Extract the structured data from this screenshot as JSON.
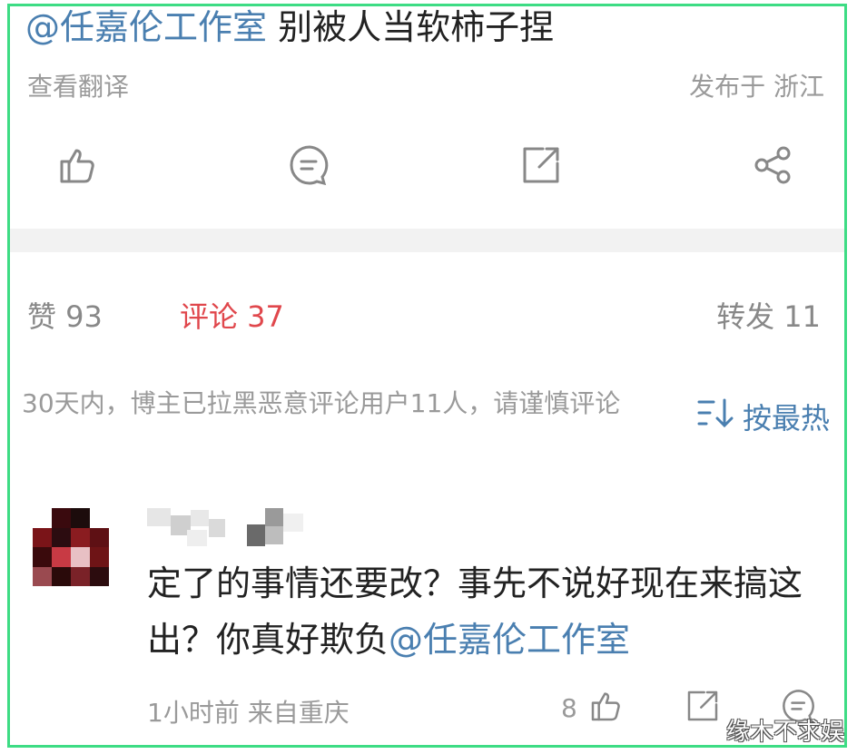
{
  "post": {
    "mention": "@任嘉伦工作室",
    "text": " 别被人当软柿子捏",
    "translate_label": "查看翻译",
    "location": "发布于 浙江"
  },
  "actions": {
    "like_icon": "thumbs-up-icon",
    "comment_icon": "comment-icon",
    "repost_icon": "repost-icon",
    "share_icon": "share-icon"
  },
  "stats": {
    "likes": "赞 93",
    "comments": "评论 37",
    "reposts": "转发 11",
    "active_color": "#e0474c"
  },
  "comments_header": {
    "hint": "30天内，博主已拉黑恶意评论用户11人，请谨慎评论",
    "sort_label": "按最热",
    "sort_icon": "sort-icon"
  },
  "comment": {
    "text": "定了的事情还要改？事先不说好现在来搞这出？你真好欺负",
    "mention": "@任嘉伦工作室",
    "time_source": "1小时前  来自重庆",
    "like_count": "8"
  },
  "watermark": "缘木不求娱",
  "colors": {
    "link": "#4a7fb0",
    "muted": "#9a9a9a",
    "frame": "#3ddc84"
  }
}
